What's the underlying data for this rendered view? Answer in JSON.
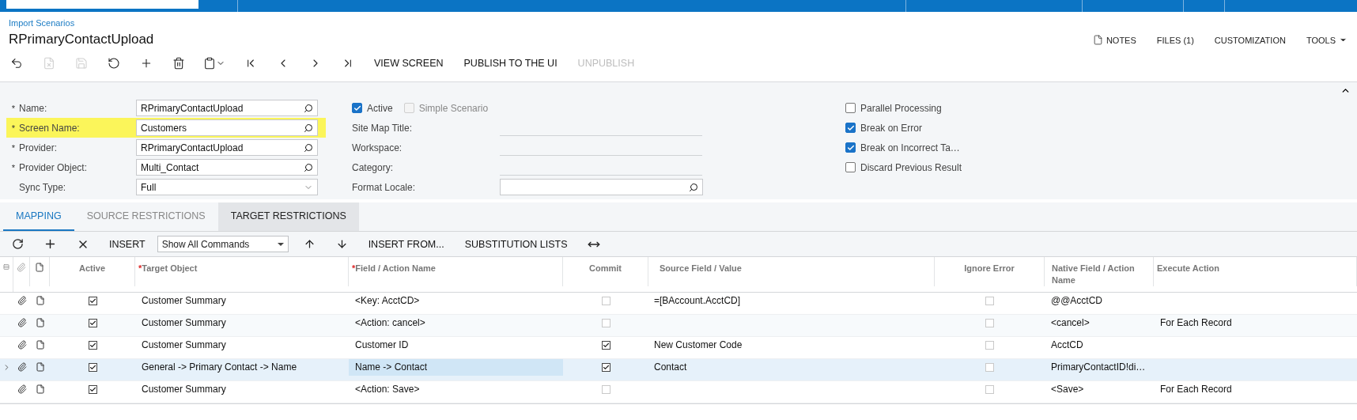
{
  "breadcrumb": "Import Scenarios",
  "title": "RPrimaryContactUpload",
  "top_actions": [
    {
      "label": "NOTES",
      "kind": "notes"
    },
    {
      "label": "FILES (1)",
      "kind": "plain"
    },
    {
      "label": "CUSTOMIZATION",
      "kind": "plain"
    },
    {
      "label": "TOOLS",
      "kind": "menu"
    }
  ],
  "toolbar": {
    "icon_buttons": [
      {
        "disabled": false
      },
      {
        "disabled": true
      },
      {
        "disabled": true
      },
      {
        "disabled": false
      },
      {
        "disabled": false
      },
      {
        "disabled": false
      },
      {
        "disabled": false
      },
      {
        "disabled": false
      },
      {
        "disabled": false
      },
      {
        "disabled": false
      },
      {
        "disabled": false
      }
    ],
    "actions": [
      {
        "label": "VIEW SCREEN",
        "disabled": false
      },
      {
        "label": "PUBLISH TO THE UI",
        "disabled": false
      },
      {
        "label": "UNPUBLISH",
        "disabled": true
      }
    ]
  },
  "form": {
    "left": [
      {
        "required_mark": "*",
        "label": "Name:",
        "value": "RPrimaryContactUpload",
        "kind": "lookup",
        "highlighted": false
      },
      {
        "required_mark": "*",
        "label": "Screen Name:",
        "value": "Customers",
        "kind": "lookup",
        "highlighted": true
      },
      {
        "required_mark": "*",
        "label": "Provider:",
        "value": "RPrimaryContactUpload",
        "kind": "lookup",
        "highlighted": false
      },
      {
        "required_mark": "*",
        "label": "Provider Object:",
        "value": "Multi_Contact",
        "kind": "lookup",
        "highlighted": false
      },
      {
        "label": "Sync Type:",
        "value": "Full",
        "kind": "select",
        "highlighted": false
      }
    ],
    "middle_checks": [
      {
        "label": "Active",
        "checked": true,
        "disabled": false
      },
      {
        "label": "Simple Scenario",
        "checked": false,
        "disabled": true
      }
    ],
    "middle_fields": [
      {
        "label": "Site Map Title:",
        "kind": "line"
      },
      {
        "label": "Workspace:",
        "kind": "line"
      },
      {
        "label": "Category:",
        "kind": "line"
      },
      {
        "label": "Format Locale:",
        "kind": "lookup"
      }
    ],
    "right": [
      {
        "label": "Parallel Processing",
        "checked": false
      },
      {
        "label": "Break on Error",
        "checked": true
      },
      {
        "label": "Break on Incorrect Ta…",
        "checked": true
      },
      {
        "label": "Discard Previous Result",
        "checked": false
      }
    ]
  },
  "tabs": [
    {
      "label": "MAPPING",
      "selected": true,
      "hovered": false
    },
    {
      "label": "SOURCE RESTRICTIONS",
      "selected": false,
      "hovered": false
    },
    {
      "label": "TARGET RESTRICTIONS",
      "selected": false,
      "hovered": true
    }
  ],
  "grid_toolbar": {
    "insert": "INSERT",
    "filter": "Show All Commands",
    "insert_from": "INSERT FROM...",
    "substitution_lists": "SUBSTITUTION LISTS"
  },
  "columns": [
    {
      "label": "Active"
    },
    {
      "required_mark": "*",
      "label": "Target Object"
    },
    {
      "required_mark": "*",
      "label": "Field / Action Name"
    },
    {
      "label": "Commit"
    },
    {
      "label": "Source Field / Value"
    },
    {
      "label": "Ignore Error"
    },
    {
      "label": "Native Field / Action Name"
    },
    {
      "label": "Execute Action"
    }
  ],
  "rows": [
    {
      "current": false,
      "active": true,
      "target_object": "Customer Summary",
      "field": "<Key: AcctCD>",
      "field_selected": false,
      "commit": false,
      "source": "=[BAccount.AcctCD]",
      "ignore_error": false,
      "native": "@@AcctCD"
    },
    {
      "current": false,
      "active": true,
      "target_object": "Customer Summary",
      "field": "<Action: cancel>",
      "field_selected": false,
      "commit": false,
      "ignore_error": false,
      "native": "<cancel>",
      "execute": "For Each Record"
    },
    {
      "current": false,
      "active": true,
      "target_object": "Customer Summary",
      "field": "Customer ID",
      "field_selected": false,
      "commit": true,
      "source": "New Customer Code",
      "ignore_error": false,
      "native": "AcctCD"
    },
    {
      "current": true,
      "active": true,
      "target_object": "General -> Primary Contact -> Name",
      "field": "Name -> Contact",
      "field_selected": true,
      "commit": true,
      "source": "Contact",
      "ignore_error": false,
      "native": "PrimaryContactID!di…"
    },
    {
      "current": false,
      "active": true,
      "target_object": "Customer Summary",
      "field": "<Action: Save>",
      "field_selected": false,
      "commit": false,
      "ignore_error": false,
      "native": "<Save>",
      "execute": "For Each Record"
    }
  ]
}
